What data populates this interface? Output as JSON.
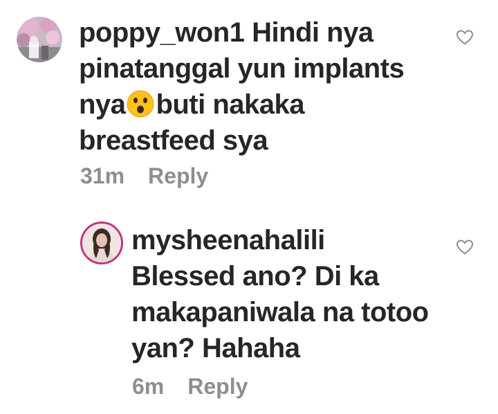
{
  "comments": [
    {
      "username": "poppy_won1",
      "text_line1_after_user": " Hindi nya",
      "text_line2": "pinatanggal yun implants",
      "text_line3_before_emoji": "nya",
      "emoji": "hushed-face",
      "text_line3_after_emoji": "buti nakaka",
      "text_line4": "breastfeed sya",
      "time": "31m",
      "reply_label": "Reply",
      "avatar_icon": "avatar-cherry-blossom",
      "like_icon": "heart-outline-icon"
    },
    {
      "username": "mysheenahalili",
      "text_line1": "Blessed ano? Di ka",
      "text_line2": "makapaniwala na totoo",
      "text_line3": "yan? Hahaha",
      "time": "6m",
      "reply_label": "Reply",
      "avatar_icon": "avatar-profile-photo",
      "like_icon": "heart-outline-icon"
    }
  ],
  "colors": {
    "text": "#262626",
    "meta": "#8e8e8e",
    "story_ring": "#c13584",
    "background": "#ffffff"
  }
}
